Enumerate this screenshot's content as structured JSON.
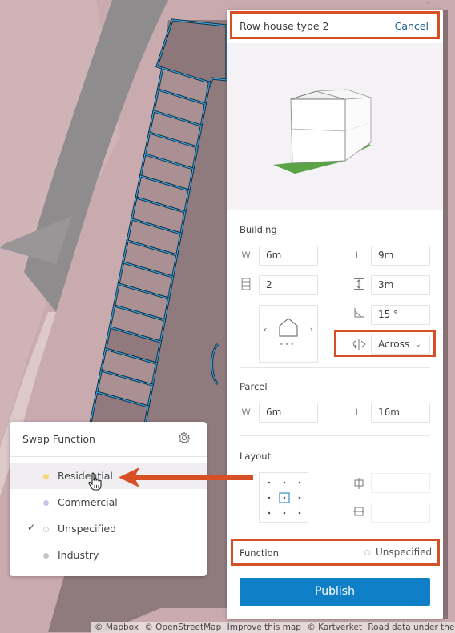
{
  "panel": {
    "title": "Row house type 2",
    "cancel_label": "Cancel",
    "building": {
      "section_label": "Building",
      "width_label": "W",
      "width_value": "6m",
      "length_label": "L",
      "length_value": "9m",
      "floors_value": "2",
      "floor_height_value": "3m",
      "roof_angle_value": "15 °",
      "orientation_value": "Across"
    },
    "parcel": {
      "section_label": "Parcel",
      "width_label": "W",
      "width_value": "6m",
      "length_label": "L",
      "length_value": "16m"
    },
    "layout": {
      "section_label": "Layout",
      "horizontal_offset_value": "",
      "vertical_offset_value": ""
    },
    "function": {
      "label": "Function",
      "value": "Unspecified"
    },
    "publish_label": "Publish"
  },
  "swap_popup": {
    "title": "Swap Function",
    "options": [
      {
        "label": "Residential",
        "color": "#f7d77a",
        "checked": false,
        "hovered": true
      },
      {
        "label": "Commercial",
        "color": "#c9c3ea",
        "checked": false,
        "hovered": false
      },
      {
        "label": "Unspecified",
        "color": "#ffffff",
        "checked": true,
        "hovered": false
      },
      {
        "label": "Industry",
        "color": "#c4c4c4",
        "checked": false,
        "hovered": false
      }
    ],
    "check_glyph": "✓"
  },
  "attribution": {
    "mapbox": "© Mapbox",
    "osm": "© OpenStreetMap",
    "improve": "Improve this map",
    "kartverket": "© Kartverket",
    "road": "Road data under the NLOD lic"
  },
  "colors": {
    "accent": "#0f7fc7",
    "highlight": "#d64f25",
    "parcel_outline": "#3fa4dd"
  }
}
